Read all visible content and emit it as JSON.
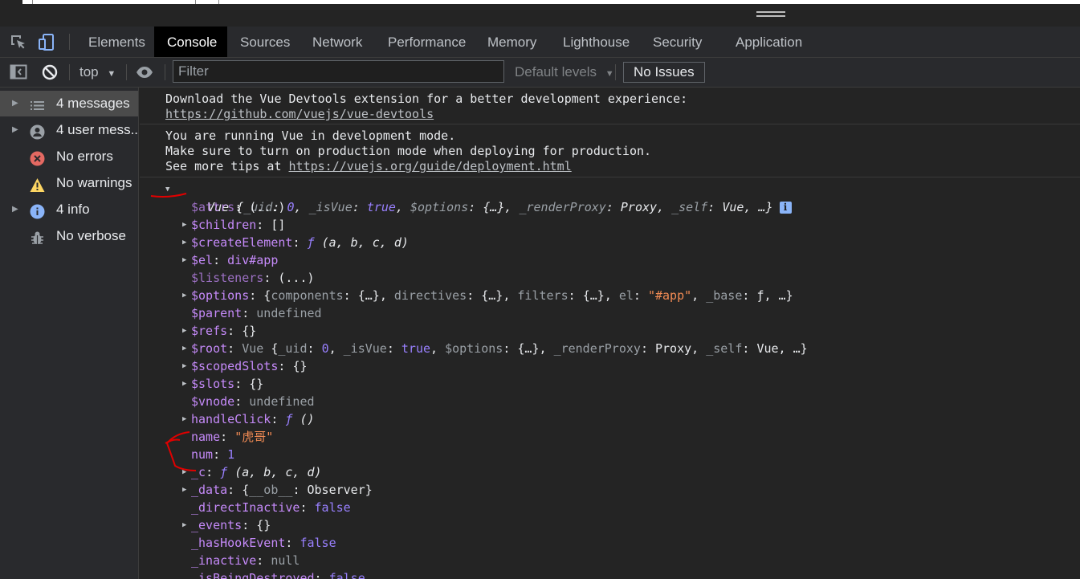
{
  "tabs": [
    "Elements",
    "Console",
    "Sources",
    "Network",
    "Performance",
    "Memory",
    "Lighthouse",
    "Security",
    "Application"
  ],
  "active_tab": "Console",
  "toolbar": {
    "context": "top",
    "filter_placeholder": "Filter",
    "levels": "Default levels",
    "issues": "No Issues"
  },
  "sidebar": {
    "items": [
      {
        "label": "4 messages",
        "icon": "list-icon",
        "expandable": true,
        "selected": true
      },
      {
        "label": "4 user mess...",
        "icon": "user-icon",
        "expandable": true,
        "selected": false
      },
      {
        "label": "No errors",
        "icon": "error-icon",
        "expandable": false,
        "selected": false
      },
      {
        "label": "No warnings",
        "icon": "warning-icon",
        "expandable": false,
        "selected": false
      },
      {
        "label": "4 info",
        "icon": "info-icon",
        "expandable": true,
        "selected": false
      },
      {
        "label": "No verbose",
        "icon": "bug-icon",
        "expandable": false,
        "selected": false
      }
    ]
  },
  "console": {
    "msg1_line1": "Download the Vue Devtools extension for a better development experience:",
    "msg1_link": "https://github.com/vuejs/vue-devtools",
    "msg2_line1": "You are running Vue in development mode.",
    "msg2_line2": "Make sure to turn on production mode when deploying for production.",
    "msg2_prefix": "See more tips at ",
    "msg2_link": "https://vuejs.org/guide/deployment.html",
    "root_summary": {
      "name": "Vue",
      "uid_key": "_uid",
      "uid": "0",
      "isvue_key": "_isVue",
      "isvue": "true",
      "options_key": "$options",
      "options": "{…}",
      "proxy_key": "_renderProxy",
      "proxy": "Proxy",
      "self_key": "_self",
      "self": "Vue",
      "ellipsis": "…"
    },
    "props": {
      "attrs": {
        "key": "$attrs",
        "value": "(...)"
      },
      "children": {
        "key": "$children",
        "value": "[]"
      },
      "createElement": {
        "key": "$createElement",
        "f": "ƒ",
        "args": "(a, b, c, d)"
      },
      "el": {
        "key": "$el",
        "value": "div#app"
      },
      "listeners": {
        "key": "$listeners",
        "value": "(...)"
      },
      "options": {
        "key": "$options",
        "components_key": "components",
        "directives_key": "directives",
        "filters_key": "filters",
        "el_key": "el",
        "el_value": "\"#app\"",
        "base_key": "_base",
        "obj": "{…}",
        "f": "ƒ",
        "ellipsis": "…"
      },
      "parent": {
        "key": "$parent",
        "value": "undefined"
      },
      "refs": {
        "key": "$refs",
        "value": "{}"
      },
      "root": {
        "key": "$root",
        "name": "Vue",
        "uid_key": "_uid",
        "uid": "0",
        "isvue_key": "_isVue",
        "isvue": "true",
        "options_key": "$options",
        "options": "{…}",
        "proxy_key": "_renderProxy",
        "proxy": "Proxy",
        "self_key": "_self",
        "self": "Vue",
        "ellipsis": "…"
      },
      "scopedSlots": {
        "key": "$scopedSlots",
        "value": "{}"
      },
      "slots": {
        "key": "$slots",
        "value": "{}"
      },
      "vnode": {
        "key": "$vnode",
        "value": "undefined"
      },
      "handleClick": {
        "key": "handleClick",
        "f": "ƒ",
        "args": "()"
      },
      "name": {
        "key": "name",
        "value": "\"虎哥\""
      },
      "num": {
        "key": "num",
        "value": "1"
      },
      "c": {
        "key": "_c",
        "f": "ƒ",
        "args": "(a, b, c, d)"
      },
      "data": {
        "key": "_data",
        "ob_key": "__ob__",
        "value": "Observer"
      },
      "directInactive": {
        "key": "_directInactive",
        "value": "false"
      },
      "events": {
        "key": "_events",
        "value": "{}"
      },
      "hasHookEvent": {
        "key": "_hasHookEvent",
        "value": "false"
      },
      "inactive": {
        "key": "_inactive",
        "value": "null"
      },
      "isBeingDestroyed": {
        "key": "_isBeingDestroyed",
        "value": "false"
      }
    }
  },
  "colors": {
    "bg": "#242424",
    "panel": "#292a2d",
    "key": "#c58af9",
    "string": "#f28b54",
    "number": "#9980ff",
    "annotation": "#e00000"
  }
}
